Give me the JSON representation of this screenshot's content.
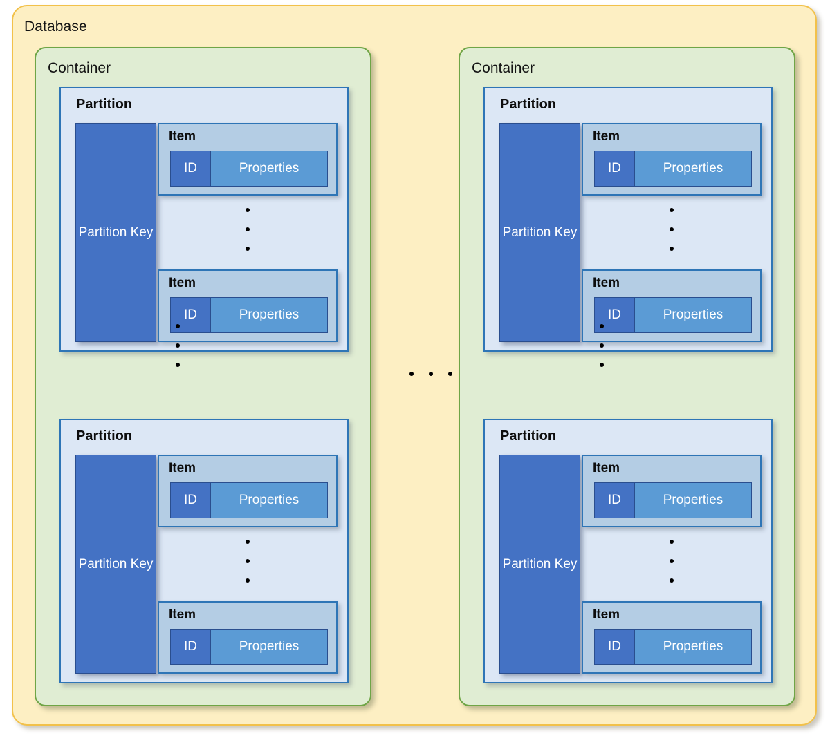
{
  "diagram": {
    "title": "Database",
    "colors": {
      "database_fill": "#FDEFC3",
      "database_border": "#F2C14A",
      "container_fill": "#E0EDD3",
      "container_border": "#6FA546",
      "partition_fill": "#DCE7F5",
      "partition_border": "#2E75B6",
      "item_fill": "#B4CDE4",
      "partition_key_fill": "#4472C4",
      "id_fill": "#4472C4",
      "properties_fill": "#5B9BD5"
    }
  },
  "labels": {
    "database": "Database",
    "container": "Container",
    "partition": "Partition",
    "partition_key": "Partition\nKey",
    "partition_key_line1": "Partition",
    "partition_key_line2": "Key",
    "item": "Item",
    "id": "ID",
    "properties": "Properties"
  },
  "containers": [
    {
      "label": "Container",
      "partitions": [
        {
          "label": "Partition",
          "partition_key": "Partition Key",
          "items": [
            {
              "label": "Item",
              "id": "ID",
              "properties": "Properties"
            },
            {
              "label": "Item",
              "id": "ID",
              "properties": "Properties"
            }
          ],
          "items_continued": true
        },
        {
          "label": "Partition",
          "partition_key": "Partition Key",
          "items": [
            {
              "label": "Item",
              "id": "ID",
              "properties": "Properties"
            },
            {
              "label": "Item",
              "id": "ID",
              "properties": "Properties"
            }
          ],
          "items_continued": true
        }
      ],
      "partitions_continued": true
    },
    {
      "label": "Container",
      "partitions": [
        {
          "label": "Partition",
          "partition_key": "Partition Key",
          "items": [
            {
              "label": "Item",
              "id": "ID",
              "properties": "Properties"
            },
            {
              "label": "Item",
              "id": "ID",
              "properties": "Properties"
            }
          ],
          "items_continued": true
        },
        {
          "label": "Partition",
          "partition_key": "Partition Key",
          "items": [
            {
              "label": "Item",
              "id": "ID",
              "properties": "Properties"
            },
            {
              "label": "Item",
              "id": "ID",
              "properties": "Properties"
            }
          ],
          "items_continued": true
        }
      ],
      "partitions_continued": true
    }
  ],
  "containers_continued": true
}
